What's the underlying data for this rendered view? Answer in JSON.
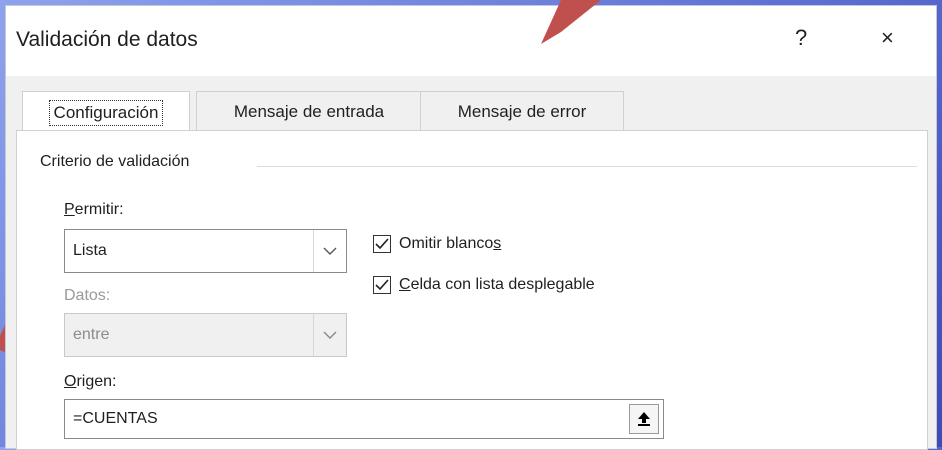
{
  "window": {
    "title": "Validación de datos",
    "help_label": "?",
    "close_label": "×"
  },
  "tabs": [
    {
      "label": "Configuración"
    },
    {
      "label": "Mensaje de entrada"
    },
    {
      "label": "Mensaje de error"
    }
  ],
  "criteria": {
    "group_title": "Criterio de validación",
    "allow": {
      "label_hotkey": "P",
      "label_rest": "ermitir:",
      "value": "Lista"
    },
    "data": {
      "label": "Datos:",
      "value": "entre"
    },
    "ignore_blank": {
      "label_main": "Omitir blanco",
      "label_hotkey": "s",
      "checked": true
    },
    "in_cell_dropdown": {
      "label_hotkey": "C",
      "label_rest": "elda con lista desplegable",
      "checked": true
    },
    "source": {
      "label_hotkey": "O",
      "label_rest": "rigen:",
      "value": "=CUENTAS"
    }
  },
  "icons": {
    "dropdown": "chevron-down-icon",
    "collapse": "upload-arrow-icon",
    "annotation_arrow": "red-arrow-annotation"
  },
  "colors": {
    "background": "#5f73d6",
    "annotation": "#c0504d"
  }
}
